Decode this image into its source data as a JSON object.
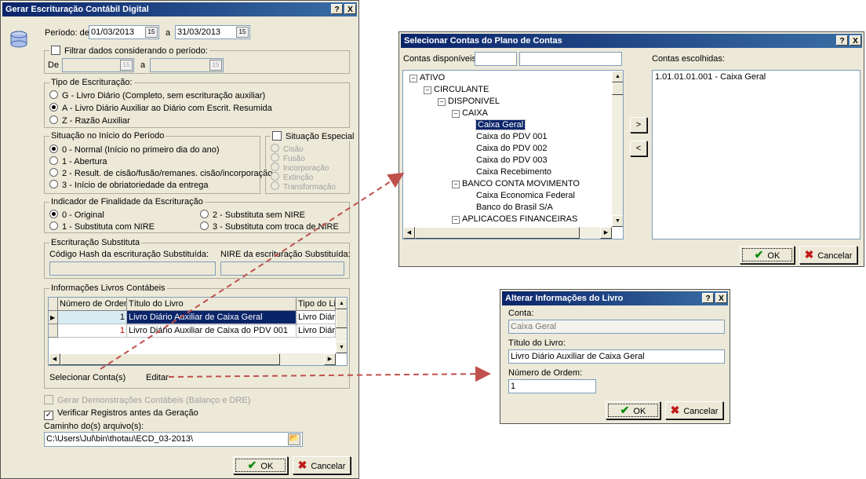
{
  "main": {
    "title": "Gerar Escrituração Contábil Digital",
    "help_btn": "?",
    "close_btn": "X",
    "periodo_label": "Período: de",
    "periodo_from": "01/03/2013",
    "periodo_a": "a",
    "periodo_to": "31/03/2013",
    "filtrar_label": "Filtrar dados considerando o período:",
    "filtrar_de": "De",
    "filtrar_a": "a",
    "tipo_title": "Tipo de Escrituração:",
    "tipo_options": [
      "G - Livro Diário (Completo, sem escrituração auxiliar)",
      "A - Livro Diário Auxiliar ao Diário com Escrit. Resumida",
      "Z - Razão Auxiliar"
    ],
    "situacao_title": "Situação no Início do Período",
    "situacao_options": [
      "0 - Normal (Início no primeiro dia do ano)",
      "1 - Abertura",
      "2 - Result. de cisão/fusão/remanes. cisão/incorporação",
      "3 - Início de obriatoriedade da entrega"
    ],
    "especial_label": "Situação Especial",
    "especial_options": [
      "Cisão",
      "Fusão",
      "Incorporação",
      "Extinção",
      "Transformação"
    ],
    "indicador_title": "Indicador de Finalidade da Escrituração",
    "indicador_options": [
      "0 - Original",
      "1 - Substituta com NIRE",
      "2 - Substituta sem NIRE",
      "3 - Substituta com troca de NIRE"
    ],
    "substituta_title": "Escrituração Substituta",
    "hash_label": "Código Hash da escrituração Substituída:",
    "nire_label": "NIRE da escrituração Substituída:",
    "livros_title": "Informações Livros Contábeis",
    "grid_headers": [
      "Número de Ordem",
      "Título do Livro",
      "Tipo do Li"
    ],
    "grid_rows": [
      {
        "ordem": "1",
        "titulo": "Livro Diário Auxiliar de Caixa Geral",
        "tipo": "Livro Diári"
      },
      {
        "ordem": "1",
        "titulo": "Livro Diário Auxiliar de Caixa do PDV 001",
        "tipo": "Livro Diári"
      }
    ],
    "selecionar_link": "Selecionar Conta(s)",
    "editar_link": "Editar",
    "gerar_demo_label": "Gerar Demonstrações Contábeis (Balanço e DRE)",
    "verificar_label": "Verificar Registros antes da Geração",
    "caminho_label": "Caminho do(s) arquivo(s):",
    "caminho_value": "C:\\Users\\Jul\\bin\\thotau\\ECD_03-2013\\",
    "ok_label": "OK",
    "cancel_label": "Cancelar"
  },
  "contas": {
    "title": "Selecionar Contas do Plano de Contas",
    "help_btn": "?",
    "close_btn": "X",
    "disponiveis_label": "Contas disponíveis:",
    "escolhidas_label": "Contas escolhidas:",
    "tree": [
      {
        "label": "ATIVO",
        "level": 0,
        "expander": "−"
      },
      {
        "label": "CIRCULANTE",
        "level": 1,
        "expander": "−"
      },
      {
        "label": "DISPONIVEL",
        "level": 2,
        "expander": "−"
      },
      {
        "label": "CAIXA",
        "level": 3,
        "expander": "−"
      },
      {
        "label": "Caixa Geral",
        "level": 4,
        "expander": "",
        "selected": true
      },
      {
        "label": "Caixa do PDV 001",
        "level": 4,
        "expander": ""
      },
      {
        "label": "Caixa do PDV 002",
        "level": 4,
        "expander": ""
      },
      {
        "label": "Caixa do PDV 003",
        "level": 4,
        "expander": ""
      },
      {
        "label": "Caixa Recebimento",
        "level": 4,
        "expander": ""
      },
      {
        "label": "BANCO CONTA MOVIMENTO",
        "level": 3,
        "expander": "−"
      },
      {
        "label": "Caixa Economica Federal",
        "level": 4,
        "expander": ""
      },
      {
        "label": "Banco do Brasil S/A",
        "level": 4,
        "expander": ""
      },
      {
        "label": "APLICACOES FINANCEIRAS",
        "level": 3,
        "expander": "−"
      }
    ],
    "chosen": [
      "1.01.01.01.001 - Caixa Geral"
    ],
    "add_btn": ">",
    "remove_btn": "<",
    "ok_label": "OK",
    "cancel_label": "Cancelar"
  },
  "alterar": {
    "title": "Alterar Informações do Livro",
    "help_btn": "?",
    "close_btn": "X",
    "conta_label": "Conta:",
    "conta_value": "Caixa Geral",
    "titulo_label": "Título do Livro:",
    "titulo_value": "Livro Diário Auxiliar de Caixa Geral",
    "ordem_label": "Número de Ordem:",
    "ordem_value": "1",
    "ok_label": "OK",
    "cancel_label": "Cancelar"
  },
  "colors": {
    "arrow": "#c0504d",
    "title_bar": "#0a246a",
    "selection": "#0a246a"
  }
}
